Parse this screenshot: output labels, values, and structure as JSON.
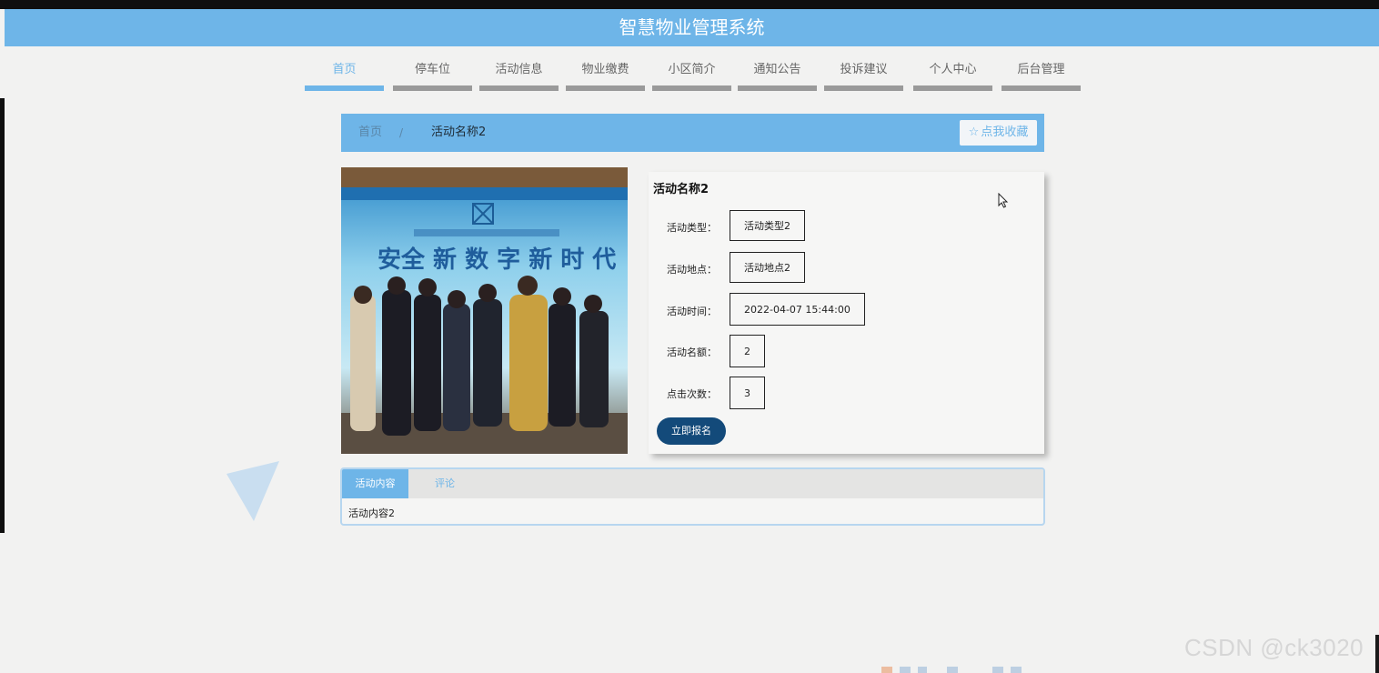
{
  "header": {
    "title": "智慧物业管理系统"
  },
  "nav": {
    "items": [
      {
        "label": "首页",
        "active": true
      },
      {
        "label": "停车位"
      },
      {
        "label": "活动信息"
      },
      {
        "label": "物业缴费"
      },
      {
        "label": "小区简介"
      },
      {
        "label": "通知公告"
      },
      {
        "label": "投诉建议"
      },
      {
        "label": "个人中心"
      },
      {
        "label": "后台管理"
      }
    ]
  },
  "breadcrumb": {
    "home": "首页",
    "separator": "/",
    "current": "活动名称2",
    "favorite_label": "点我收藏",
    "favorite_icon": "star-outline-icon"
  },
  "activity": {
    "title": "活动名称2",
    "fields": [
      {
        "label": "活动类型：",
        "value": "活动类型2"
      },
      {
        "label": "活动地点：",
        "value": "活动地点2"
      },
      {
        "label": "活动时间：",
        "value": "2022-04-07 15:44:00"
      },
      {
        "label": "活动名额：",
        "value": "2"
      },
      {
        "label": "点击次数：",
        "value": "3"
      }
    ],
    "signup_label": "立即报名",
    "image": {
      "banner_text": "安全 新 数 字 新 时 代"
    }
  },
  "tabs": {
    "items": [
      {
        "label": "活动内容",
        "active": true
      },
      {
        "label": "评论"
      }
    ],
    "content": "活动内容2"
  },
  "watermark": "CSDN @ck3020",
  "colors": {
    "primary": "#6eb5e8",
    "button_dark": "#134a7a",
    "background": "#f2f2f1",
    "nav_underline": "#9a9a9a"
  }
}
